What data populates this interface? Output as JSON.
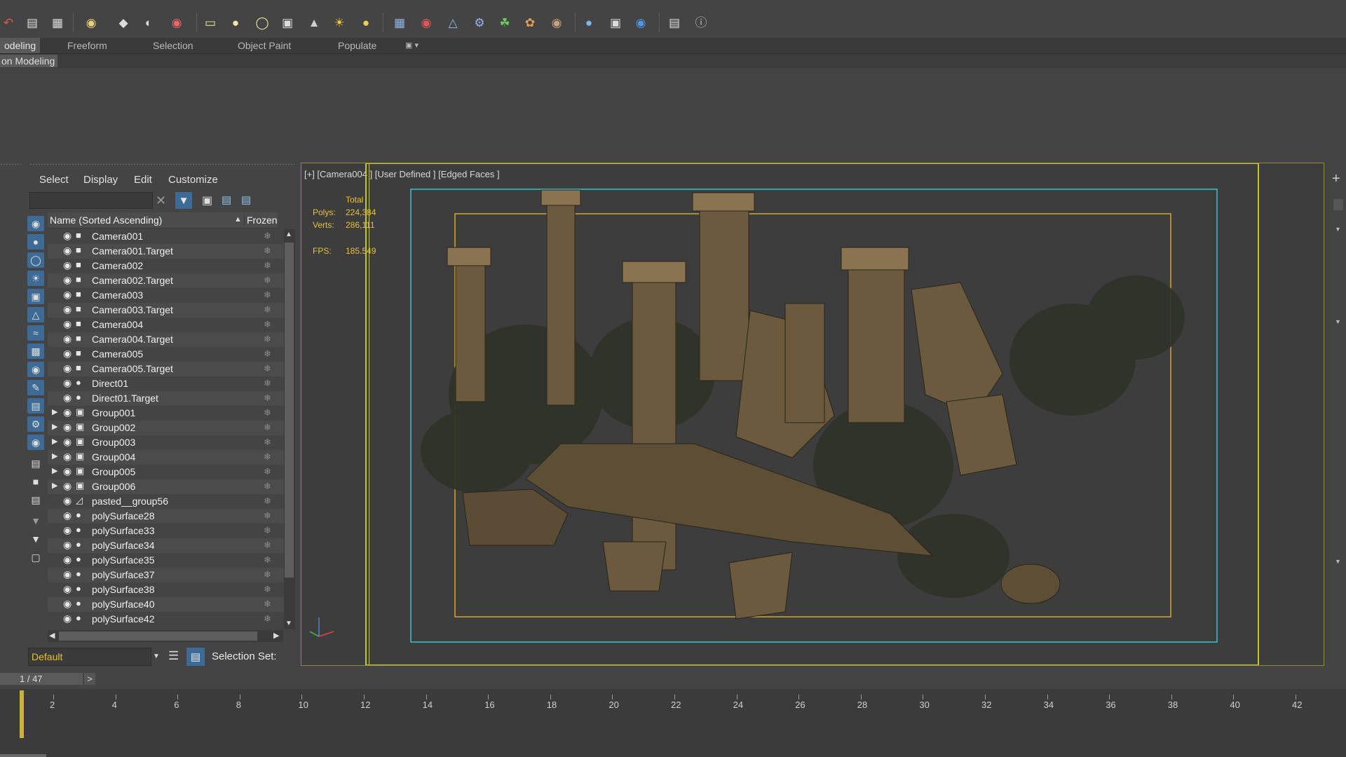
{
  "toolbar": {
    "icons": [
      "undo-icon",
      "redo-icon",
      "layer-manager-icon",
      "scene-explorer-icon",
      "light-lister-icon",
      "camera-icon",
      "teapot-icon",
      "cylinder-icon",
      "box-icon",
      "sphere-icon",
      "plane-icon",
      "cone-icon",
      "sun-icon",
      "target-light-icon",
      "scatter-icon",
      "bend-icon",
      "compass-icon",
      "gear-icon",
      "grass-icon",
      "hair-fur-icon",
      "tree-icon",
      "material-sphere-icon",
      "render-setup-icon",
      "render-frame-icon",
      "render-production-icon",
      "help-icon"
    ]
  },
  "ribbon": {
    "tabs": [
      "odeling",
      "Freeform",
      "Selection",
      "Object Paint",
      "Populate"
    ],
    "active_tab": "odeling",
    "sub_tab": "on Modeling"
  },
  "explorer": {
    "menus": [
      "Select",
      "Display",
      "Edit",
      "Customize"
    ],
    "column_name": "Name (Sorted Ascending)",
    "column_frozen": "Frozen",
    "rows": [
      {
        "name": "Camera001",
        "type": "camera",
        "expand": false
      },
      {
        "name": "Camera001.Target",
        "type": "camera",
        "expand": false
      },
      {
        "name": "Camera002",
        "type": "camera",
        "expand": false
      },
      {
        "name": "Camera002.Target",
        "type": "camera",
        "expand": false
      },
      {
        "name": "Camera003",
        "type": "camera",
        "expand": false
      },
      {
        "name": "Camera003.Target",
        "type": "camera",
        "expand": false
      },
      {
        "name": "Camera004",
        "type": "camera",
        "expand": false
      },
      {
        "name": "Camera004.Target",
        "type": "camera",
        "expand": false
      },
      {
        "name": "Camera005",
        "type": "camera",
        "expand": false
      },
      {
        "name": "Camera005.Target",
        "type": "camera",
        "expand": false
      },
      {
        "name": "Direct01",
        "type": "light",
        "expand": false
      },
      {
        "name": "Direct01.Target",
        "type": "light",
        "expand": false
      },
      {
        "name": "Group001",
        "type": "group",
        "expand": true
      },
      {
        "name": "Group002",
        "type": "group",
        "expand": true
      },
      {
        "name": "Group003",
        "type": "group",
        "expand": true
      },
      {
        "name": "Group004",
        "type": "group",
        "expand": true
      },
      {
        "name": "Group005",
        "type": "group",
        "expand": true
      },
      {
        "name": "Group006",
        "type": "group",
        "expand": true
      },
      {
        "name": "pasted__group56",
        "type": "helper",
        "expand": false
      },
      {
        "name": "polySurface28",
        "type": "geometry",
        "expand": false
      },
      {
        "name": "polySurface33",
        "type": "geometry",
        "expand": false
      },
      {
        "name": "polySurface34",
        "type": "geometry",
        "expand": false
      },
      {
        "name": "polySurface35",
        "type": "geometry",
        "expand": false
      },
      {
        "name": "polySurface37",
        "type": "geometry",
        "expand": false
      },
      {
        "name": "polySurface38",
        "type": "geometry",
        "expand": false
      },
      {
        "name": "polySurface40",
        "type": "geometry",
        "expand": false
      },
      {
        "name": "polySurface42",
        "type": "geometry",
        "expand": false
      }
    ],
    "layer_value": "Default",
    "selection_set_label": "Selection Set:"
  },
  "viewport": {
    "label": "[+] [Camera004 ] [User Defined ] [Edged Faces ]",
    "stats_total": "Total",
    "polys_label": "Polys:",
    "polys_value": "224,384",
    "verts_label": "Verts:",
    "verts_value": "286,111",
    "fps_label": "FPS:",
    "fps_value": "185.549"
  },
  "timeline": {
    "frame_counter": "1 / 47",
    "next_label": ">",
    "ticks": [
      "2",
      "4",
      "6",
      "8",
      "10",
      "12",
      "14",
      "16",
      "18",
      "20",
      "22",
      "24",
      "26",
      "28",
      "30",
      "32",
      "34",
      "36",
      "38",
      "40",
      "42"
    ]
  },
  "colors": {
    "safe_frame_outer": "#c9c238",
    "safe_frame_action": "#36c7cf",
    "safe_frame_title": "#d0a830",
    "stats_text": "#e7c233",
    "accent_blue": "#3e6b96"
  }
}
